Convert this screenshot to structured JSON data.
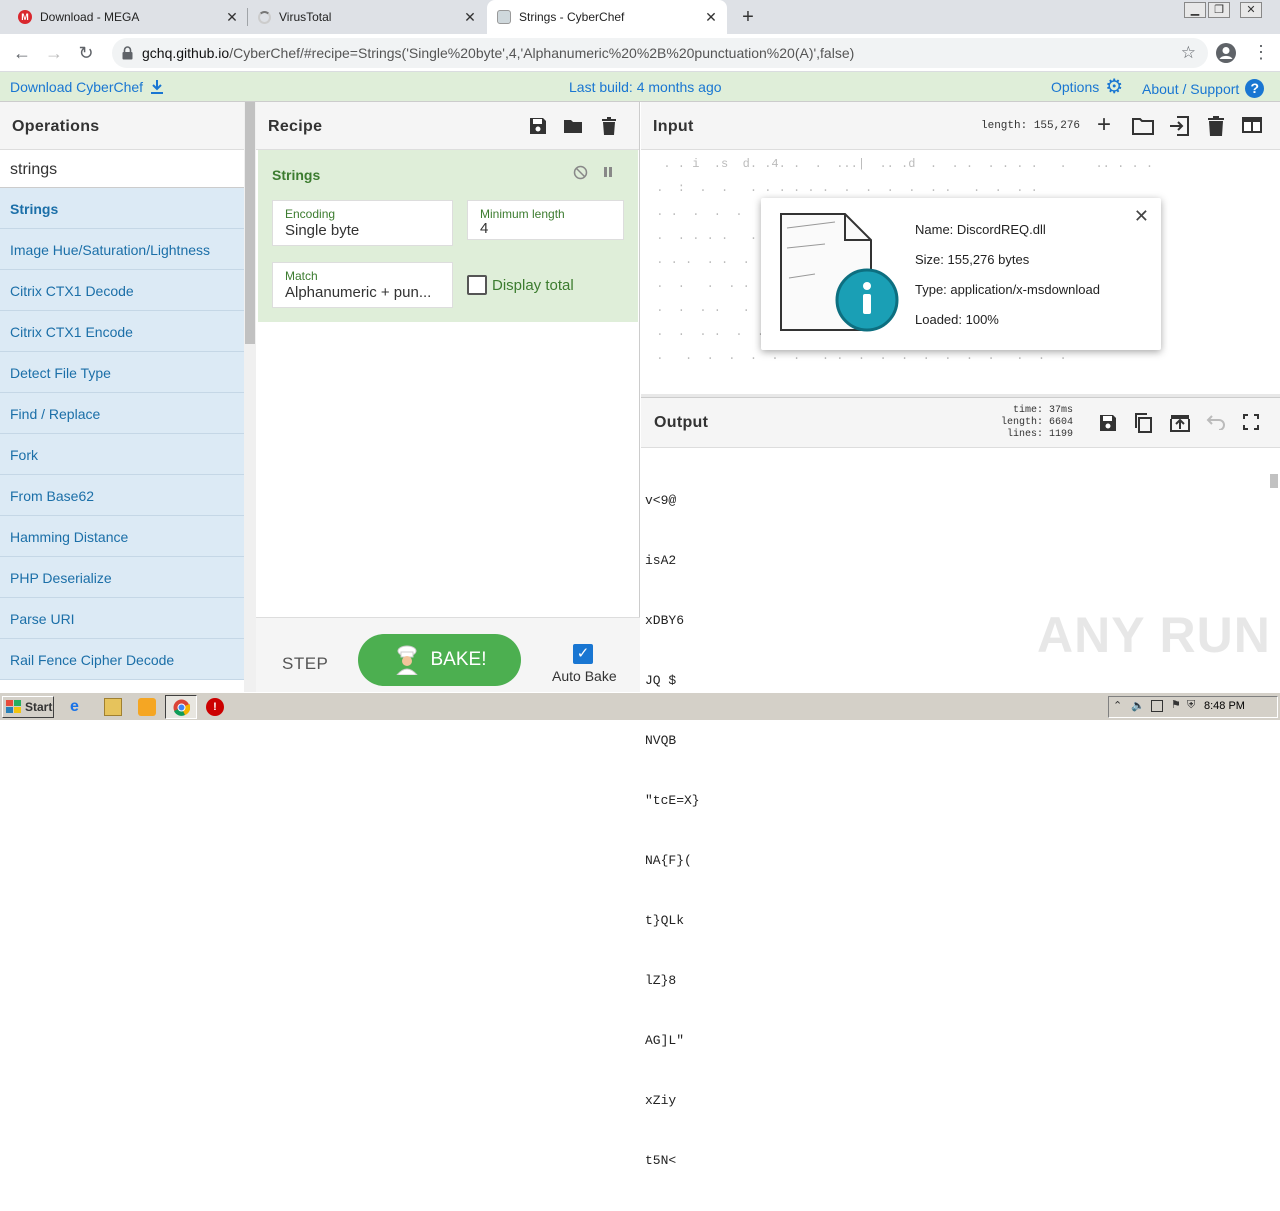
{
  "browser": {
    "tabs": [
      {
        "title": "Download - MEGA",
        "icon": "mega-icon"
      },
      {
        "title": "VirusTotal",
        "icon": "loading-icon"
      },
      {
        "title": "Strings - CyberChef",
        "icon": "cyberchef-icon"
      }
    ],
    "url_host": "gchq.github.io",
    "url_path": "/CyberChef/#recipe=Strings('Single%20byte',4,'Alphanumeric%20%2B%20punctuation%20(A)',false)"
  },
  "banner": {
    "download": "Download CyberChef",
    "last_build": "Last build: 4 months ago",
    "options": "Options",
    "about": "About / Support"
  },
  "operations": {
    "title": "Operations",
    "search_value": "strings",
    "items": [
      "Strings",
      "Image Hue/Saturation/Lightness",
      "Citrix CTX1 Decode",
      "Citrix CTX1 Encode",
      "Detect File Type",
      "Find / Replace",
      "Fork",
      "From Base62",
      "Hamming Distance",
      "PHP Deserialize",
      "Parse URI",
      "Rail Fence Cipher Decode"
    ]
  },
  "recipe": {
    "title": "Recipe",
    "operation": {
      "name": "Strings",
      "encoding_label": "Encoding",
      "encoding_value": "Single byte",
      "minlen_label": "Minimum length",
      "minlen_value": "4",
      "match_label": "Match",
      "match_value": "Alphanumeric + pun...",
      "display_total_label": "Display total",
      "display_total_checked": false
    },
    "step": "STEP",
    "bake": "BAKE!",
    "auto_bake": "Auto Bake",
    "auto_bake_checked": true
  },
  "input": {
    "title": "Input",
    "length_label": "length:",
    "length_value": "155,276",
    "file": {
      "name": "Name: DiscordREQ.dll",
      "size": "Size: 155,276 bytes",
      "type": "Type: application/x-msdownload",
      "loaded": "Loaded: 100%"
    }
  },
  "output": {
    "title": "Output",
    "time": "time: 37ms",
    "length": "length: 6604",
    "lines": "lines: 1199",
    "content_lines": [
      "v<9@",
      "isA2",
      "xDBY6",
      "JQ $",
      "NVQB",
      "\"tcE=X}",
      "NA{F}(",
      "t}QLk",
      "lZ}8",
      "AG]L\"",
      "xZiy",
      "t5N<"
    ]
  },
  "taskbar": {
    "start": "Start",
    "clock": "8:48 PM"
  },
  "watermark": "ANY RUN",
  "colors": {
    "accent_blue": "#1976d2",
    "recipe_green": "#dfeed9",
    "bake_green": "#4caf50",
    "ops_item_bg": "#dceaf5"
  }
}
